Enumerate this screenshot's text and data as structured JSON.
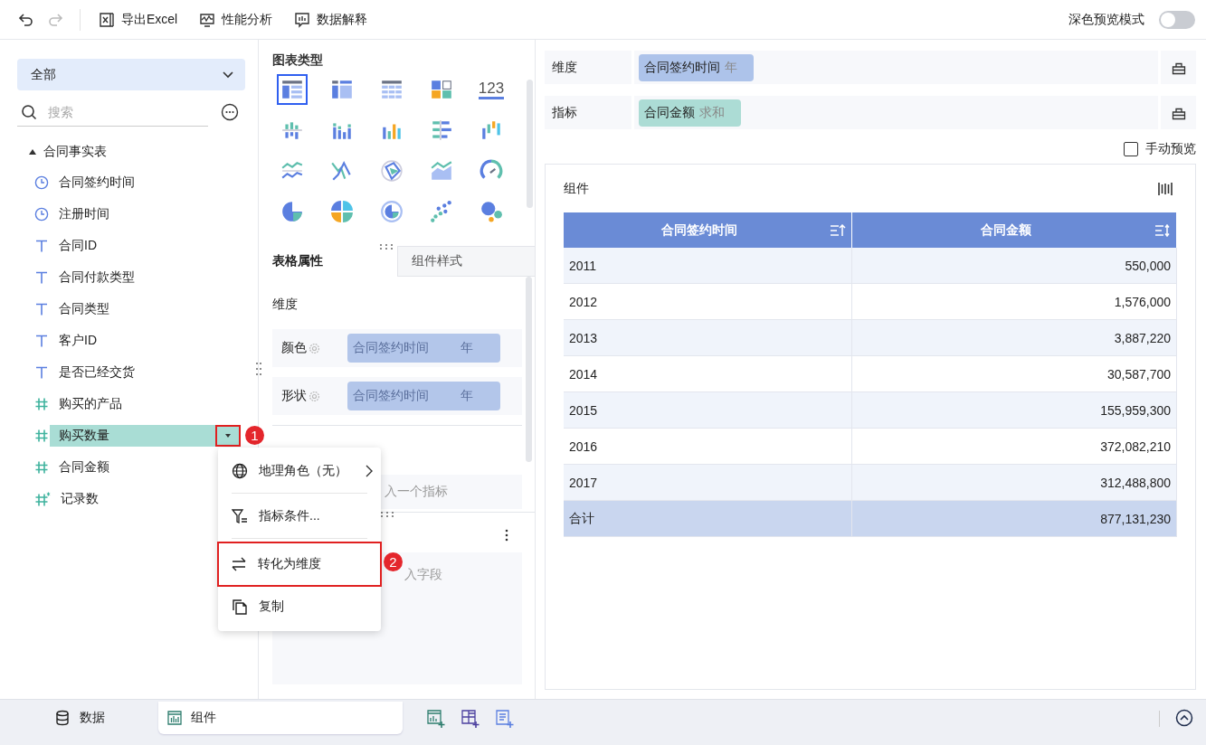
{
  "toolbar": {
    "undo": {
      "disabled": false
    },
    "redo": {
      "disabled": true
    },
    "actions": [
      {
        "label": "导出Excel",
        "kind": "excel"
      },
      {
        "label": "性能分析",
        "kind": "performance"
      },
      {
        "label": "数据解释",
        "kind": "explain"
      }
    ],
    "dark_preview": {
      "label": "深色预览模式",
      "on": false
    }
  },
  "data_panel": {
    "scope": "全部",
    "search": {
      "placeholder": "搜索"
    },
    "tree": {
      "label": "合同事实表",
      "expanded": true,
      "children": [
        {
          "label": "合同签约时间",
          "kind": "date",
          "selected": false
        },
        {
          "label": "注册时间",
          "kind": "date",
          "selected": false
        },
        {
          "label": "合同ID",
          "kind": "text",
          "selected": false
        },
        {
          "label": "合同付款类型",
          "kind": "text",
          "selected": false
        },
        {
          "label": "合同类型",
          "kind": "text",
          "selected": false
        },
        {
          "label": "客户ID",
          "kind": "text",
          "selected": false
        },
        {
          "label": "是否已经交货",
          "kind": "text",
          "selected": false
        },
        {
          "label": "购买的产品",
          "kind": "number",
          "selected": false
        },
        {
          "label": "购买数量",
          "kind": "number",
          "selected": true,
          "callout": "1"
        },
        {
          "label": "合同金额",
          "kind": "number",
          "selected": false
        },
        {
          "label": "记录数",
          "kind": "computed",
          "selected": false
        }
      ]
    }
  },
  "context_menu": {
    "items": [
      {
        "label": "地理角色（无）",
        "kind": "geo",
        "submenu": true,
        "highlighted": false
      },
      {
        "label": "指标条件...",
        "kind": "filter",
        "submenu": false,
        "highlighted": false
      },
      {
        "label": "转化为维度",
        "kind": "convert",
        "submenu": false,
        "highlighted": true,
        "callout": "2"
      },
      {
        "label": "复制",
        "kind": "copy",
        "submenu": false,
        "highlighted": false
      }
    ]
  },
  "chart_types": {
    "title": "图表类型",
    "items": [
      {
        "selected": true
      },
      {
        "selected": false
      },
      {
        "selected": false
      },
      {
        "selected": false
      },
      {
        "selected": false,
        "label": "123"
      },
      {
        "selected": false
      },
      {
        "selected": false
      },
      {
        "selected": false
      },
      {
        "selected": false
      },
      {
        "selected": false
      },
      {
        "selected": false
      },
      {
        "selected": false
      },
      {
        "selected": false
      },
      {
        "selected": false
      },
      {
        "selected": false
      },
      {
        "selected": false
      },
      {
        "selected": false
      },
      {
        "selected": false
      },
      {
        "selected": false
      },
      {
        "selected": false
      }
    ]
  },
  "property_tabs": [
    {
      "label": "表格属性",
      "selected": true
    },
    {
      "label": "组件样式",
      "selected": false
    }
  ],
  "dimension_section": {
    "title": "维度",
    "rows": [
      {
        "label": "颜色",
        "field": "合同签约时间",
        "unit": "年",
        "disabled": true
      },
      {
        "label": "形状",
        "field": "合同签约时间",
        "unit": "年",
        "disabled": true
      }
    ]
  },
  "measure_section": {
    "placeholder": "入一个指标"
  },
  "detail_section": {
    "placeholder": "入字段"
  },
  "shelves": [
    {
      "label": "维度",
      "field": "合同签约时间",
      "aggregation": "年",
      "kind": "dimension"
    },
    {
      "label": "指标",
      "field": "合同金额",
      "aggregation": "求和",
      "kind": "measure"
    }
  ],
  "manual_preview": {
    "label": "手动预览",
    "checked": false
  },
  "component": {
    "title": "组件",
    "table": {
      "columns": [
        {
          "label": "合同签约时间",
          "sorted": true
        },
        {
          "label": "合同金额",
          "sorted": false
        }
      ],
      "rows": [
        {
          "cells": [
            "2011",
            "550,000"
          ],
          "kind": "data"
        },
        {
          "cells": [
            "2012",
            "1,576,000"
          ],
          "kind": "data"
        },
        {
          "cells": [
            "2013",
            "3,887,220"
          ],
          "kind": "data"
        },
        {
          "cells": [
            "2014",
            "30,587,700"
          ],
          "kind": "data"
        },
        {
          "cells": [
            "2015",
            "155,959,300"
          ],
          "kind": "data"
        },
        {
          "cells": [
            "2016",
            "372,082,210"
          ],
          "kind": "data"
        },
        {
          "cells": [
            "2017",
            "312,488,800"
          ],
          "kind": "data"
        },
        {
          "cells": [
            "合计",
            "877,131,230"
          ],
          "kind": "total"
        }
      ]
    }
  },
  "bottom_tabs": [
    {
      "label": "数据",
      "kind": "data",
      "selected": false
    },
    {
      "label": "组件",
      "kind": "component",
      "selected": true
    }
  ]
}
